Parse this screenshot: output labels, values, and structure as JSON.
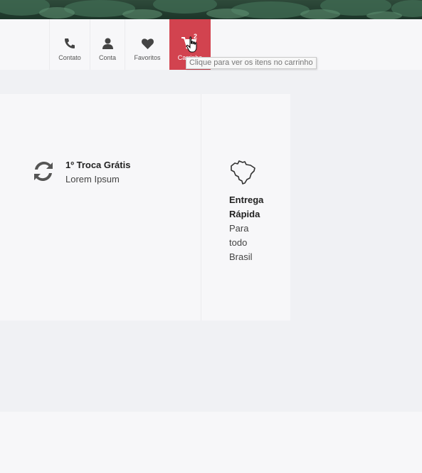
{
  "nav": {
    "contato": "Contato",
    "conta": "Conta",
    "favoritos": "Favoritos",
    "carrinho": "Carrinho",
    "cart_count": "2",
    "tooltip": "Clique para ver os itens no carrinho"
  },
  "features": {
    "troca": {
      "title": "1º Troca Grátis",
      "subtitle": "Lorem Ipsum"
    },
    "entrega": {
      "title_line1": "Entrega",
      "title_line2": "Rápida",
      "sub_line1": "Para",
      "sub_line2": "todo",
      "sub_line3": "Brasil"
    }
  },
  "colors": {
    "cart_bg": "#d2434f",
    "banner": "#1c3529"
  }
}
